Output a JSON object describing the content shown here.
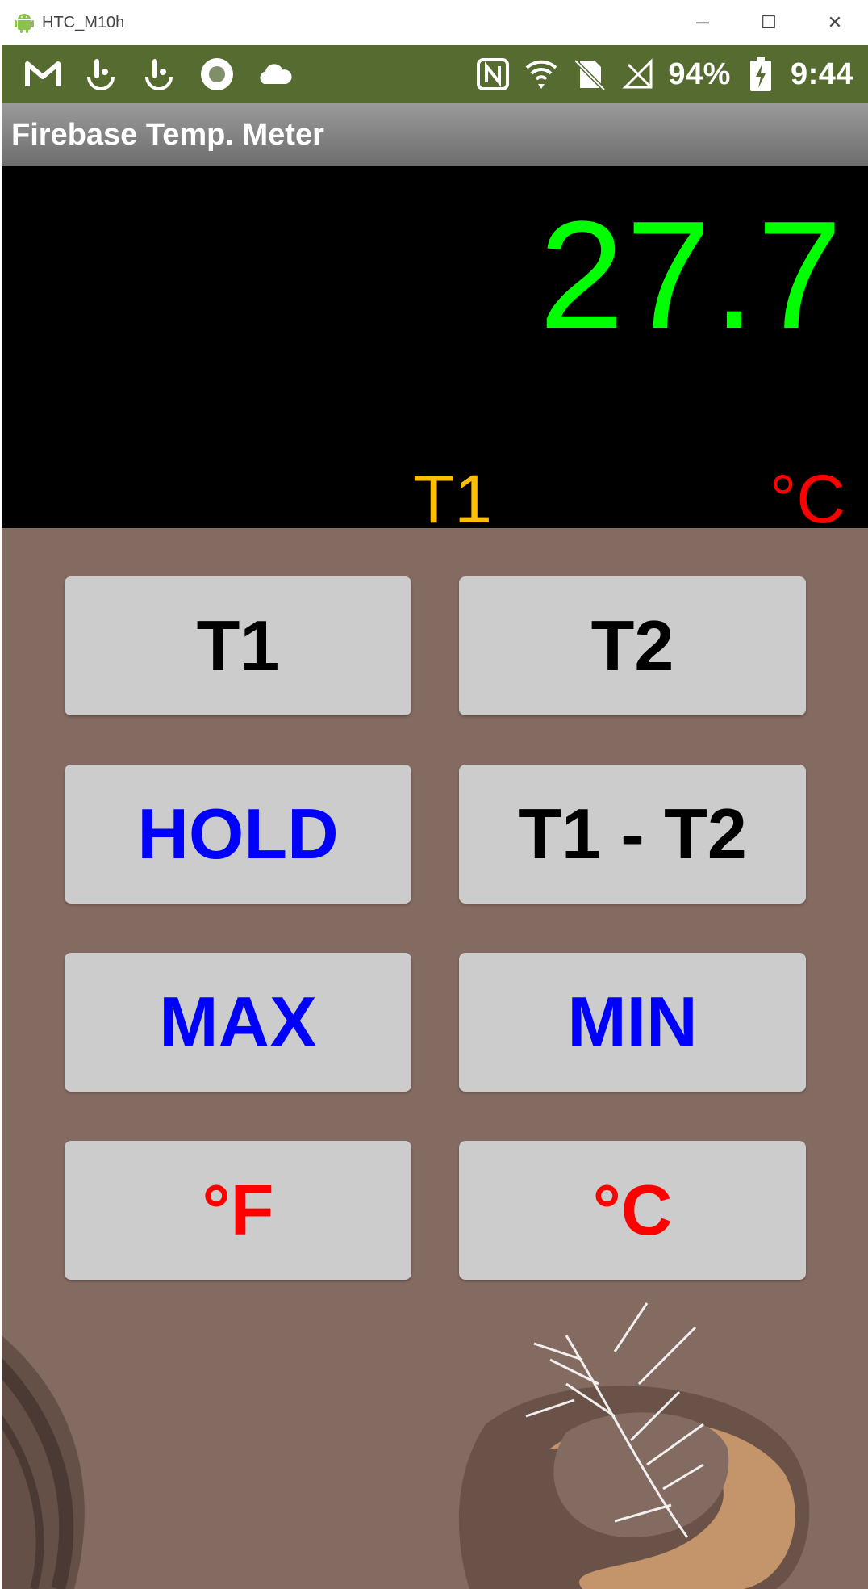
{
  "window": {
    "title": "HTC_M10h",
    "controls": {
      "minimize": "─",
      "maximize": "☐",
      "close": "✕"
    }
  },
  "status_bar": {
    "left_icons": [
      "gmail-icon",
      "touch-icon",
      "touch-icon",
      "record-icon",
      "cloud-icon"
    ],
    "right_icons": [
      "nfc-icon",
      "wifi-icon",
      "no-sim-icon",
      "signal-icon",
      "battery-charging-icon"
    ],
    "battery": "94%",
    "time": "9:44",
    "background": "#556b2f"
  },
  "app": {
    "title": "Firebase Temp. Meter"
  },
  "display": {
    "reading": "27.7",
    "sensor": "T1",
    "unit": "°C",
    "colors": {
      "reading": "#00ff00",
      "sensor": "#ffbf00",
      "unit": "#ff0000",
      "background": "#000000"
    }
  },
  "buttons": {
    "t1": "T1",
    "t2": "T2",
    "hold": "HOLD",
    "diff": "T1 - T2",
    "max": "MAX",
    "min": "MIN",
    "fahrenheit": "°F",
    "celsius": "°C"
  },
  "colors": {
    "controls_background": "#846b62",
    "button_background": "#cccccc"
  }
}
